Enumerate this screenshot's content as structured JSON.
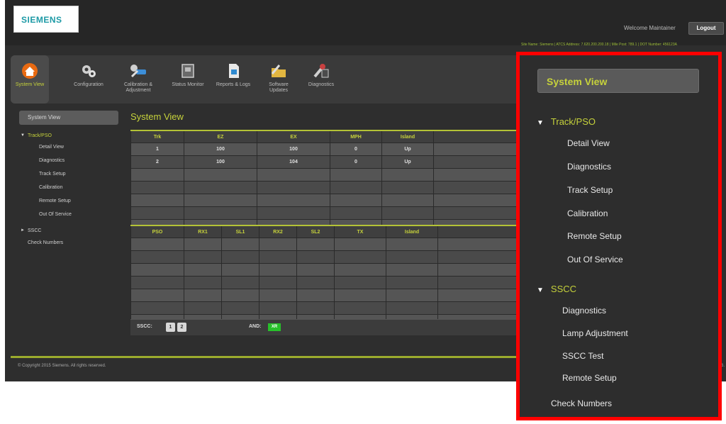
{
  "header": {
    "logo": "SIEMENS",
    "welcome": "Welcome Maintainer",
    "logout_label": "Logout",
    "site_info": "Site Name: Siemens | ATCS Address: 7.620.200.200.18 | Mile Post: 789.1 | DOT Number: 456123A"
  },
  "toolbar": {
    "items": [
      {
        "label": "System View",
        "icon": "house-icon"
      },
      {
        "label": "Configuration",
        "icon": "gears-icon"
      },
      {
        "label": "Calibration & Adjustment",
        "icon": "wrench-icon"
      },
      {
        "label": "Status Monitor",
        "icon": "monitor-icon"
      },
      {
        "label": "Reports & Logs",
        "icon": "document-icon"
      },
      {
        "label": "Software Updates",
        "icon": "folder-icon"
      },
      {
        "label": "Diagnostics",
        "icon": "tools-icon"
      }
    ]
  },
  "left_nav": {
    "header": "System View",
    "track_group": "Track/PSO",
    "track_items": [
      "Detail View",
      "Diagnostics",
      "Track Setup",
      "Calibration",
      "Remote Setup",
      "Out Of Service"
    ],
    "sscc_group": "SSCC",
    "check_numbers": "Check Numbers"
  },
  "main": {
    "title": "System View",
    "track_table": {
      "columns": [
        "Trk",
        "EZ",
        "EX",
        "MPH",
        "Island",
        ""
      ],
      "rows": [
        [
          "1",
          "100",
          "100",
          "0",
          "Up",
          ""
        ],
        [
          "2",
          "100",
          "104",
          "0",
          "Up",
          ""
        ],
        [
          "",
          "",
          "",
          "",
          "",
          ""
        ],
        [
          "",
          "",
          "",
          "",
          "",
          ""
        ],
        [
          "",
          "",
          "",
          "",
          "",
          ""
        ],
        [
          "",
          "",
          "",
          "",
          "",
          ""
        ],
        [
          "",
          "",
          "",
          "",
          "",
          ""
        ]
      ]
    },
    "pso_table": {
      "columns": [
        "PSO",
        "RX1",
        "SL1",
        "RX2",
        "SL2",
        "TX",
        "Island",
        ""
      ],
      "rows": [
        [
          "",
          "",
          "",
          "",
          "",
          "",
          "",
          ""
        ],
        [
          "",
          "",
          "",
          "",
          "",
          "",
          "",
          ""
        ],
        [
          "",
          "",
          "",
          "",
          "",
          "",
          "",
          ""
        ],
        [
          "",
          "",
          "",
          "",
          "",
          "",
          "",
          ""
        ],
        [
          "",
          "",
          "",
          "",
          "",
          "",
          "",
          ""
        ],
        [
          "",
          "",
          "",
          "",
          "",
          "",
          "",
          ""
        ],
        [
          "",
          "",
          "",
          "",
          "",
          "",
          "",
          ""
        ]
      ]
    },
    "sscc_bar": {
      "sscc_label": "SSCC:",
      "sscc_buttons": [
        "1",
        "2"
      ],
      "and_label": "AND:",
      "and_value": "XR"
    }
  },
  "footer": {
    "copyright": "© Copyright 2015 Siemens. All rights reserved.",
    "right_text": "6."
  },
  "callout": {
    "header": "System View",
    "track_group": "Track/PSO",
    "track_items": [
      "Detail View",
      "Diagnostics",
      "Track Setup",
      "Calibration",
      "Remote Setup",
      "Out Of Service"
    ],
    "sscc_group": "SSCC",
    "sscc_items": [
      "Diagnostics",
      "Lamp Adjustment",
      "SSCC Test",
      "Remote Setup"
    ],
    "check_numbers": "Check Numbers"
  },
  "colors": {
    "accent": "#c6d23b",
    "highlight_border": "#ff0000",
    "and_indicator": "#27c02a"
  }
}
